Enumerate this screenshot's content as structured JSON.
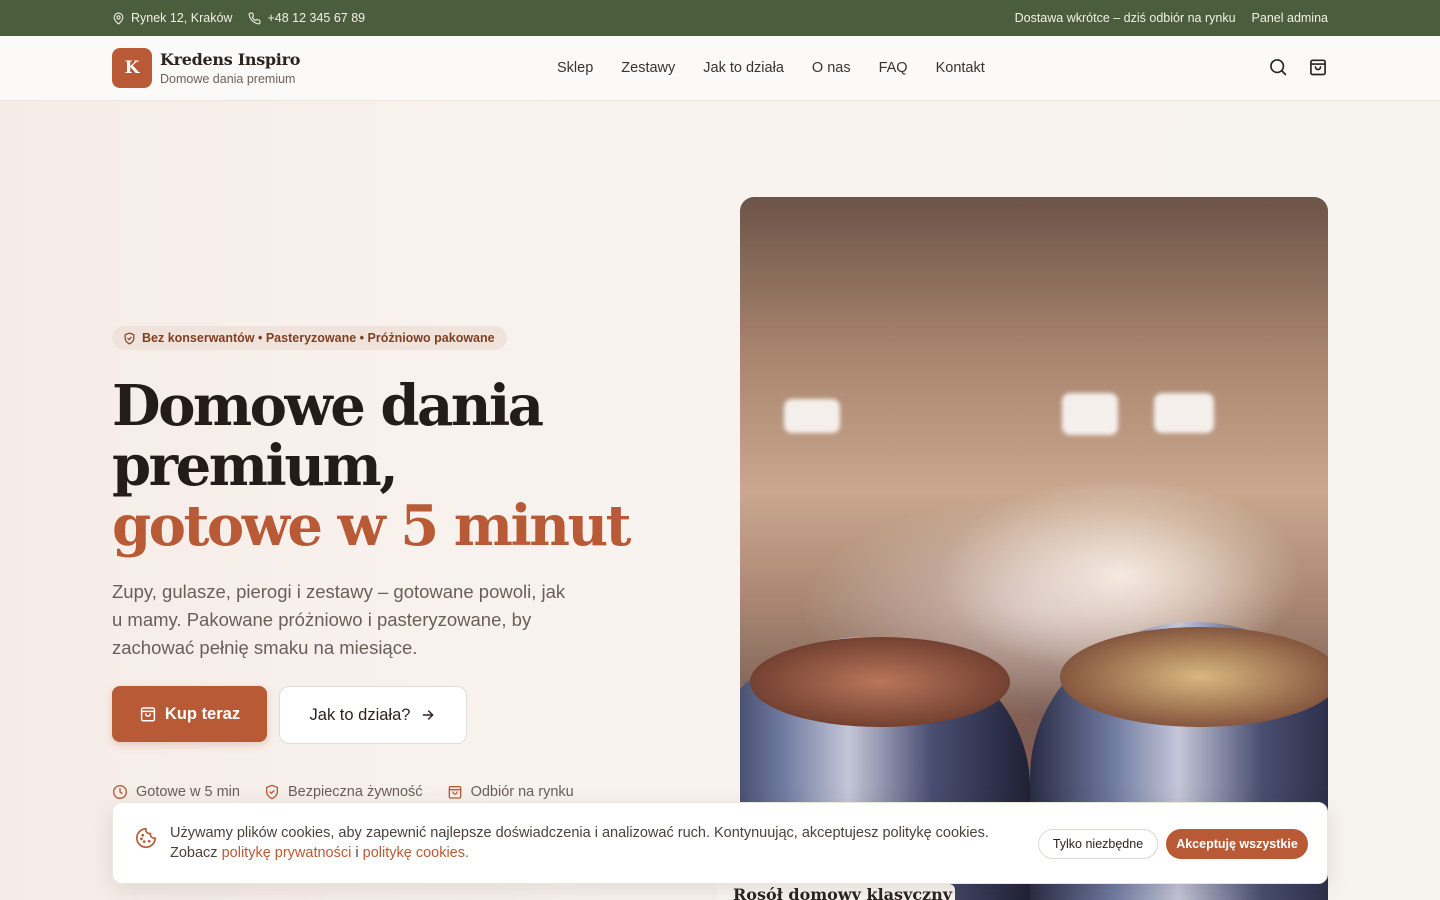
{
  "topbar": {
    "address": "Rynek 12, Kraków",
    "phone": "+48 12 345 67 89",
    "delivery_note": "Dostawa wkrótce – dziś odbiór na rynku",
    "admin_link": "Panel admina"
  },
  "brand": {
    "logo_letter": "K",
    "name": "Kredens Inspiro",
    "tagline": "Domowe dania premium"
  },
  "nav": {
    "items": [
      "Sklep",
      "Zestawy",
      "Jak to działa",
      "O nas",
      "FAQ",
      "Kontakt"
    ]
  },
  "header_icons": [
    "search-icon",
    "shopping-bag-icon"
  ],
  "hero": {
    "badge": "Bez konserwantów • Pasteryzowane • Próżniowo pakowane",
    "title_line1": "Domowe dania",
    "title_line2": "premium,",
    "title_accent": "gotowe w 5 minut",
    "lead": "Zupy, gulasze, pierogi i zestawy – gotowane powoli, jak u mamy. Pakowane próżniowo i pasteryzowane, by zachować pełnię smaku na miesiące.",
    "primary_button": "Kup teraz",
    "secondary_button": "Jak to działa?",
    "features": [
      "Gotowe w 5 min",
      "Bezpieczna żywność",
      "Odbiór na rynku"
    ]
  },
  "product_card": {
    "title": "Rosół domowy klasyczny"
  },
  "cookie_banner": {
    "text": "Używamy plików cookies, aby zapewnić najlepsze doświadczenia i analizować ruch. Kontynuując, akceptujesz politykę cookies.",
    "see_prefix": "Zobacz",
    "privacy_link": "politykę prywatności",
    "and": "i",
    "cookies_link": "politykę cookies",
    "period": ".",
    "essential_button": "Tylko niezbędne",
    "accept_button": "Akceptuję wszystkie"
  },
  "colors": {
    "topbar_bg": "#4a5e3d",
    "accent": "#b85a35",
    "text_dark": "#231c18",
    "text_muted": "#6a5f58"
  }
}
